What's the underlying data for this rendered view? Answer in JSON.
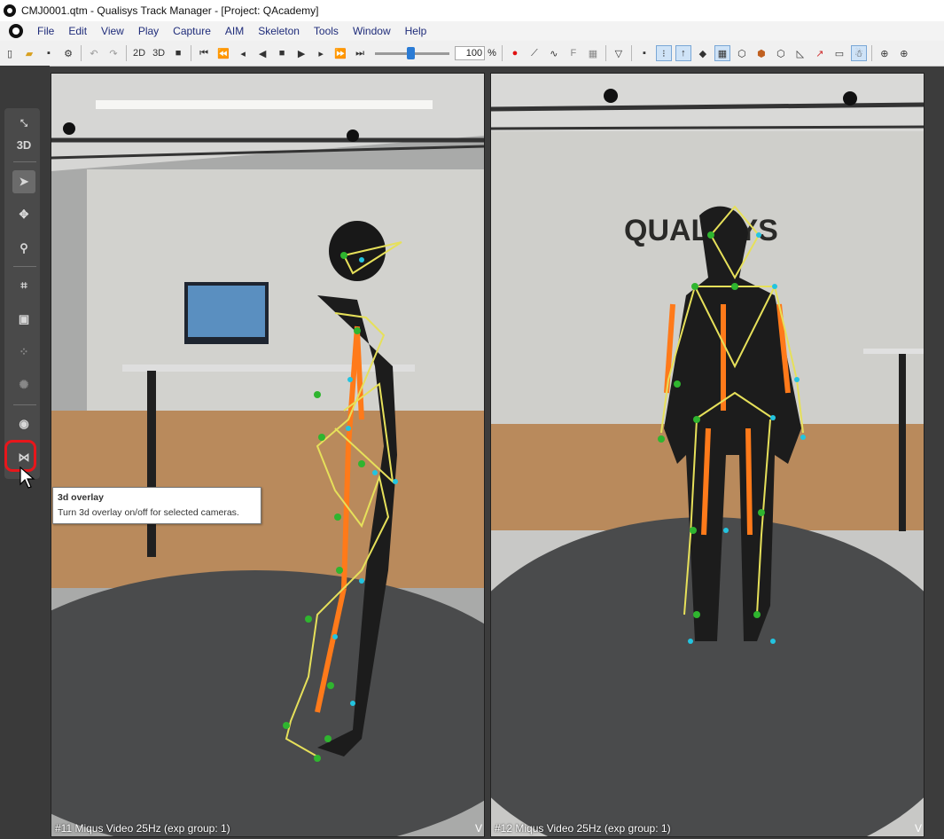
{
  "window": {
    "title": "CMJ0001.qtm - Qualisys Track Manager - [Project: QAcademy]"
  },
  "menu": [
    "File",
    "Edit",
    "View",
    "Play",
    "Capture",
    "AIM",
    "Skeleton",
    "Tools",
    "Window",
    "Help"
  ],
  "toolbar": {
    "btn_2d": "2D",
    "btn_3d": "3D",
    "speed_value": "100",
    "speed_unit": "%",
    "marker_f": "F"
  },
  "side_toolbar": {
    "mode_label": "3D"
  },
  "tooltip": {
    "title": "3d overlay",
    "description": "Turn 3d overlay on/off for selected cameras."
  },
  "views": [
    {
      "label": "#11 Miqus Video 25Hz (exp group: 1)",
      "flag": "V"
    },
    {
      "label": "#12 Miqus Video 25Hz (exp group: 1)",
      "flag": "V"
    }
  ],
  "colors": {
    "highlight": "#e8161b",
    "bone": "#ff7a1a",
    "segment": "#e6e05a",
    "marker_green": "#2fb52f",
    "marker_cyan": "#23c4e0"
  },
  "icons": [
    "new-file-icon",
    "open-folder-icon",
    "save-icon",
    "settings-gear-icon",
    "undo-icon",
    "redo-icon",
    "record-icon",
    "pointer-icon",
    "move-icon",
    "zoom-icon",
    "crop-icon",
    "camera-icon",
    "overlay-3d-icon"
  ],
  "brand_text": "QUALISYS"
}
